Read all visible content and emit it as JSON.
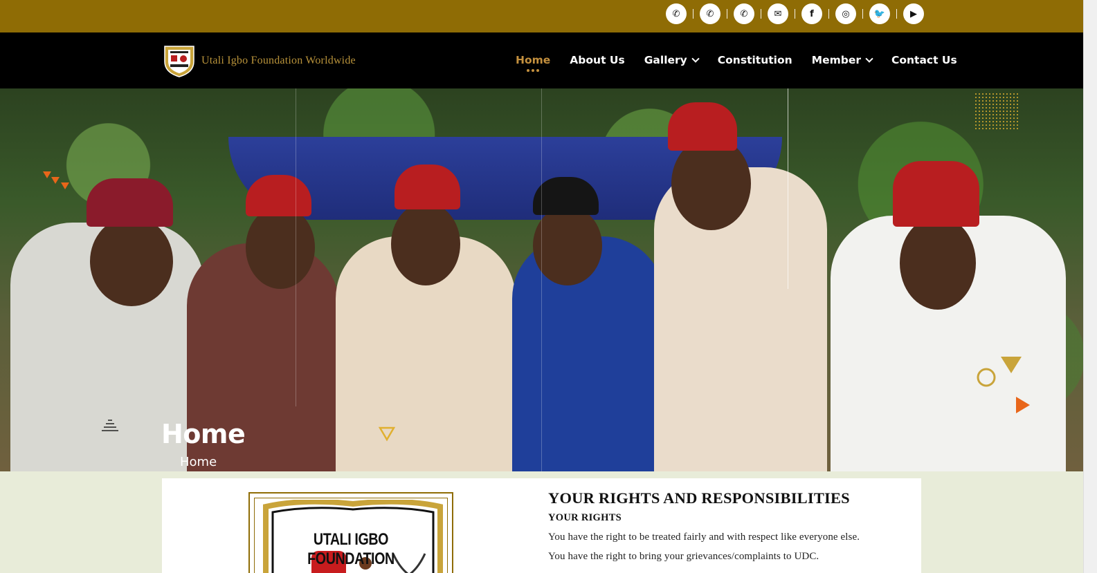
{
  "topbar": {
    "social": [
      {
        "icon": "phone-icon",
        "glyph": "✆"
      },
      {
        "icon": "phone-icon",
        "glyph": "✆"
      },
      {
        "icon": "phone-icon",
        "glyph": "✆"
      },
      {
        "icon": "envelope-icon",
        "glyph": "✉"
      },
      {
        "icon": "facebook-icon",
        "glyph": "f"
      },
      {
        "icon": "instagram-icon",
        "glyph": "◎"
      },
      {
        "icon": "twitter-icon",
        "glyph": "🐦"
      },
      {
        "icon": "youtube-icon",
        "glyph": "▶"
      }
    ]
  },
  "header": {
    "brand": "Utali Igbo Foundation Worldwide",
    "logo_text": "UTALI IGBO FOUNDATION",
    "nav": [
      {
        "label": "Home",
        "active": true,
        "dropdown": false
      },
      {
        "label": "About Us",
        "active": false,
        "dropdown": false
      },
      {
        "label": "Gallery",
        "active": false,
        "dropdown": true
      },
      {
        "label": "Constitution",
        "active": false,
        "dropdown": false
      },
      {
        "label": "Member",
        "active": false,
        "dropdown": true
      },
      {
        "label": "Contact Us",
        "active": false,
        "dropdown": false
      }
    ]
  },
  "hero": {
    "title": "Home",
    "breadcrumb": "Home"
  },
  "content": {
    "crest_text": "UTALI IGBO FOUNDATION",
    "section_title": "YOUR RIGHTS AND RESPONSIBILITIES",
    "subtitle": "YOUR RIGHTS",
    "paragraphs": [
      "You have the right to be treated fairly and with respect like everyone else.",
      "You have the right to bring your grievances/complaints to UDC."
    ]
  },
  "colors": {
    "gold": "#8f6c05",
    "accent": "#c4903e",
    "nav_bg": "#000000",
    "orange": "#e8661a"
  }
}
